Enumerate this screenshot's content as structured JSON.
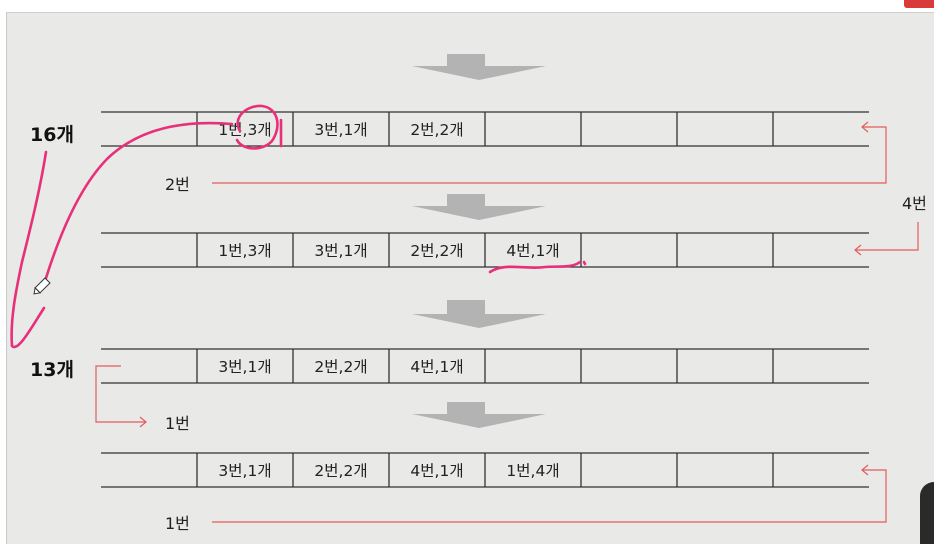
{
  "rows": [
    {
      "cells": [
        "1번,3개",
        "3번,1개",
        "2번,2개",
        "",
        "",
        "",
        ""
      ]
    },
    {
      "cells": [
        "1번,3개",
        "3번,1개",
        "2번,2개",
        "4번,1개",
        "",
        "",
        ""
      ]
    },
    {
      "cells": [
        "3번,1개",
        "2번,2개",
        "4번,1개",
        "",
        "",
        "",
        ""
      ]
    },
    {
      "cells": [
        "3번,1개",
        "2번,2개",
        "4번,1개",
        "1번,4개",
        "",
        "",
        ""
      ]
    }
  ],
  "counts": {
    "row1": "16개",
    "row3": "13개"
  },
  "feeds": {
    "row1_in": "2번",
    "row2_in": "4번",
    "row3_out": "1번",
    "row4_in": "1번"
  },
  "colors": {
    "slide_bg": "#e9e9e7",
    "grid_line": "#333333",
    "feed_arrow": "#e35d5d",
    "transition_arrow": "#b3b3b3",
    "pen_ink": "#e8307a"
  },
  "icons": {
    "cursor": "pencil-cursor-icon"
  }
}
